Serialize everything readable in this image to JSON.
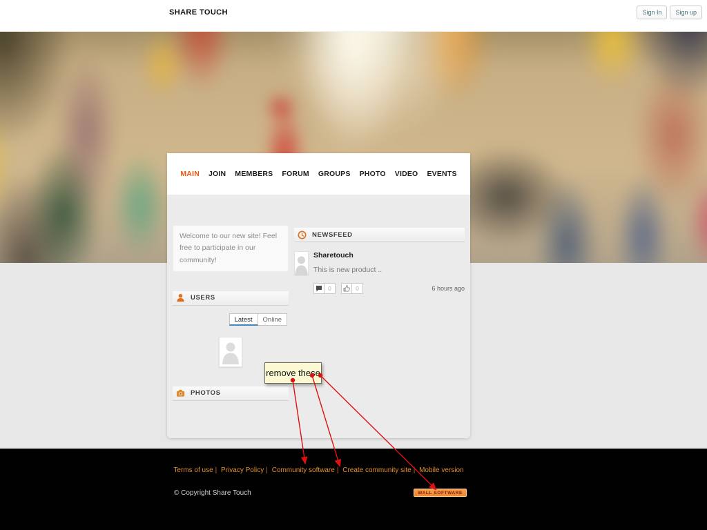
{
  "topbar": {
    "logo": "SHARE TOUCH",
    "sign_in": "Sign In",
    "sign_up": "Sign up"
  },
  "nav": {
    "items": [
      {
        "label": "MAIN",
        "active": true
      },
      {
        "label": "JOIN",
        "active": false
      },
      {
        "label": "MEMBERS",
        "active": false
      },
      {
        "label": "FORUM",
        "active": false
      },
      {
        "label": "GROUPS",
        "active": false
      },
      {
        "label": "PHOTO",
        "active": false
      },
      {
        "label": "VIDEO",
        "active": false
      },
      {
        "label": "EVENTS",
        "active": false
      }
    ]
  },
  "left": {
    "welcome": "Welcome to our new site! Feel free to participate in our community!",
    "users_header": "USERS",
    "tabs": [
      "Latest",
      "Online"
    ],
    "photos_header": "PHOTOS"
  },
  "newsfeed": {
    "header": "NEWSFEED",
    "post": {
      "author": "Sharetouch",
      "text": "This is new product ..",
      "comments_count": "0",
      "likes_count": "0",
      "time": "6 hours ago"
    }
  },
  "annotation": {
    "note": "remove these"
  },
  "footer": {
    "links": [
      "Terms of use",
      "Privacy Policy",
      "Community software",
      "Create community site",
      "Mobile version"
    ],
    "separator": "|",
    "copyright": "© Copyright Share Touch",
    "watermark": "WALL SOFTWARE"
  },
  "colors": {
    "accent_orange": "#ed550a",
    "header_icon_orange": "#e07020",
    "footer_link_orange": "#e0922f",
    "watermark_bg": "#f0893a",
    "arrow_red": "#dd1111",
    "tab_active_underline": "#4488bb",
    "footer_bg": "#010101",
    "card_body_bg": "#ebebeb",
    "page_bg": "#e7e7e7"
  }
}
